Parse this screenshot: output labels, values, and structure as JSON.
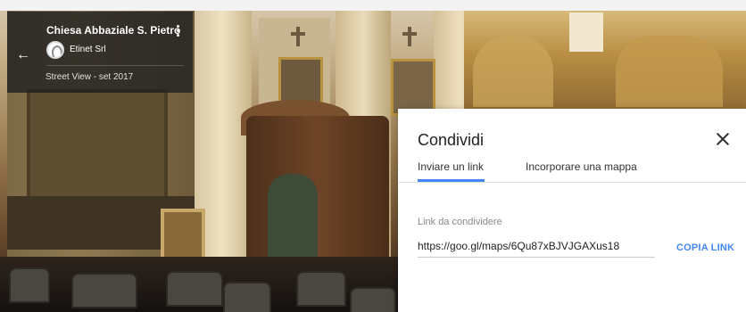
{
  "info_card": {
    "back_icon": "arrow-left-icon",
    "title": "Chiesa Abbaziale S. Pietro",
    "more_icon": "more-vert-icon",
    "author_icon": "author-avatar",
    "author": "Etinet Srl",
    "date": "Street View - set 2017"
  },
  "share_dialog": {
    "title": "Condividi",
    "close_icon": "close-icon",
    "tabs": [
      {
        "label": "Inviare un link",
        "active": true
      },
      {
        "label": "Incorporare una mappa",
        "active": false
      }
    ],
    "field_label": "Link da condividere",
    "link_value": "https://goo.gl/maps/6Qu87xBJVJGAXus18",
    "copy_label": "COPIA LINK",
    "accent_color": "#4285f4"
  }
}
